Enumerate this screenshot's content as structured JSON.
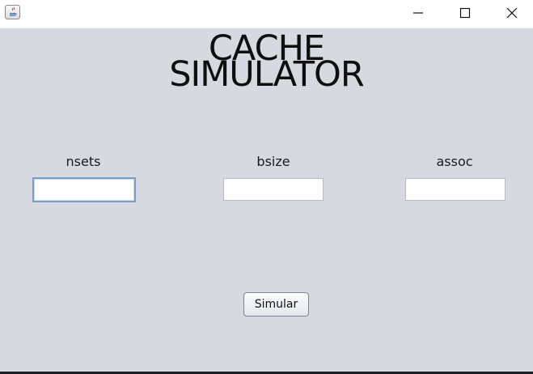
{
  "window": {
    "controls": {
      "minimize_icon": "minimize-icon",
      "maximize_icon": "maximize-icon",
      "close_icon": "close-icon"
    }
  },
  "header": {
    "title_line1": "CACHE",
    "title_line2": "SIMULATOR"
  },
  "form": {
    "nsets": {
      "label": "nsets",
      "value": ""
    },
    "bsize": {
      "label": "bsize",
      "value": ""
    },
    "assoc": {
      "label": "assoc",
      "value": ""
    },
    "submit_label": "Simular"
  },
  "colors": {
    "background": "#d6d9e0",
    "titlebar": "#ffffff",
    "focus_border": "#7a9ec7"
  }
}
